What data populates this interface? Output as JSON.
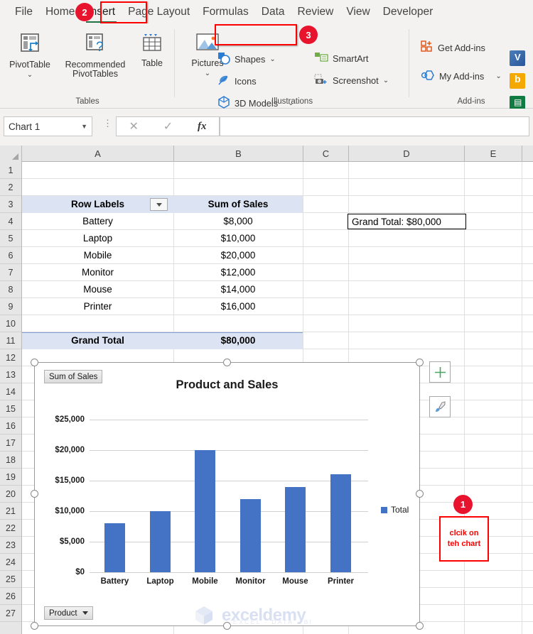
{
  "ribbon": {
    "tabs": [
      {
        "label": "File",
        "active": false
      },
      {
        "label": "Home",
        "active": false
      },
      {
        "label": "Insert",
        "active": true
      },
      {
        "label": "Page Layout",
        "active": false
      },
      {
        "label": "Formulas",
        "active": false
      },
      {
        "label": "Data",
        "active": false
      },
      {
        "label": "Review",
        "active": false
      },
      {
        "label": "View",
        "active": false
      },
      {
        "label": "Developer",
        "active": false
      }
    ],
    "groups": [
      {
        "label": "Tables"
      },
      {
        "label": "Illustrations"
      },
      {
        "label": "Add-ins"
      }
    ],
    "tables_group": {
      "pivottable": "PivotTable",
      "recommended_line1": "Recommended",
      "recommended_line2": "PivotTables",
      "table": "Table"
    },
    "illustrations_group": {
      "pictures": "Pictures",
      "shapes": "Shapes",
      "icons": "Icons",
      "models_3d": "3D Models",
      "smartart": "SmartArt",
      "screenshot": "Screenshot"
    },
    "addins_group": {
      "get_addins": "Get Add-ins",
      "my_addins": "My Add-ins"
    }
  },
  "badges": [
    {
      "num": "1"
    },
    {
      "num": "2"
    },
    {
      "num": "3"
    }
  ],
  "formula_bar": {
    "name_box": "Chart 1",
    "cancel_icon": "✕",
    "confirm_icon": "✓",
    "fx_label": "fx",
    "formula_value": ""
  },
  "grid": {
    "columns": [
      "A",
      "B",
      "C",
      "D",
      "E"
    ],
    "rows": [
      "1",
      "2",
      "3",
      "4",
      "5",
      "6",
      "7",
      "8",
      "9",
      "10",
      "11",
      "12",
      "13",
      "14",
      "15",
      "16",
      "17",
      "18",
      "19",
      "20",
      "21",
      "22",
      "23",
      "24",
      "25",
      "26",
      "27"
    ]
  },
  "pivot_table": {
    "header": {
      "row_labels": "Row Labels",
      "sum_of_sales": "Sum of Sales"
    },
    "rows": [
      {
        "label": "Battery",
        "value": "$8,000"
      },
      {
        "label": "Laptop",
        "value": "$10,000"
      },
      {
        "label": "Mobile",
        "value": "$20,000"
      },
      {
        "label": "Monitor",
        "value": "$12,000"
      },
      {
        "label": "Mouse",
        "value": "$14,000"
      },
      {
        "label": "Printer",
        "value": "$16,000"
      }
    ],
    "grand_total": {
      "label": "Grand Total",
      "value": "$80,000"
    }
  },
  "text_box": {
    "grand_total_note": "Grand Total: $80,000"
  },
  "chart": {
    "value_field_button": "Sum of Sales",
    "axis_field_button": "Product",
    "side_buttons": {
      "add_element": "+",
      "styles": "brush-icon"
    }
  },
  "annotation": {
    "note_line1": "clcik on",
    "note_line2": "teh chart"
  },
  "watermark": {
    "brand": "exceldemy",
    "tagline": "EXCEL - DATA - BI"
  },
  "chart_data": {
    "type": "bar",
    "title": "Product and Sales",
    "categories": [
      "Battery",
      "Laptop",
      "Mobile",
      "Monitor",
      "Mouse",
      "Printer"
    ],
    "values": [
      8000,
      10000,
      20000,
      12000,
      14000,
      16000
    ],
    "series": [
      {
        "name": "Total",
        "values": [
          8000,
          10000,
          20000,
          12000,
          14000,
          16000
        ]
      }
    ],
    "legend": [
      "Total"
    ],
    "legend_position": "right",
    "xlabel": "",
    "ylabel": "",
    "ylim": [
      0,
      25000
    ],
    "ytick_labels": [
      "$0",
      "$5,000",
      "$10,000",
      "$15,000",
      "$20,000",
      "$25,000"
    ],
    "ytick_values": [
      0,
      5000,
      10000,
      15000,
      20000,
      25000
    ],
    "grid": true,
    "bar_color": "#4472c4"
  }
}
